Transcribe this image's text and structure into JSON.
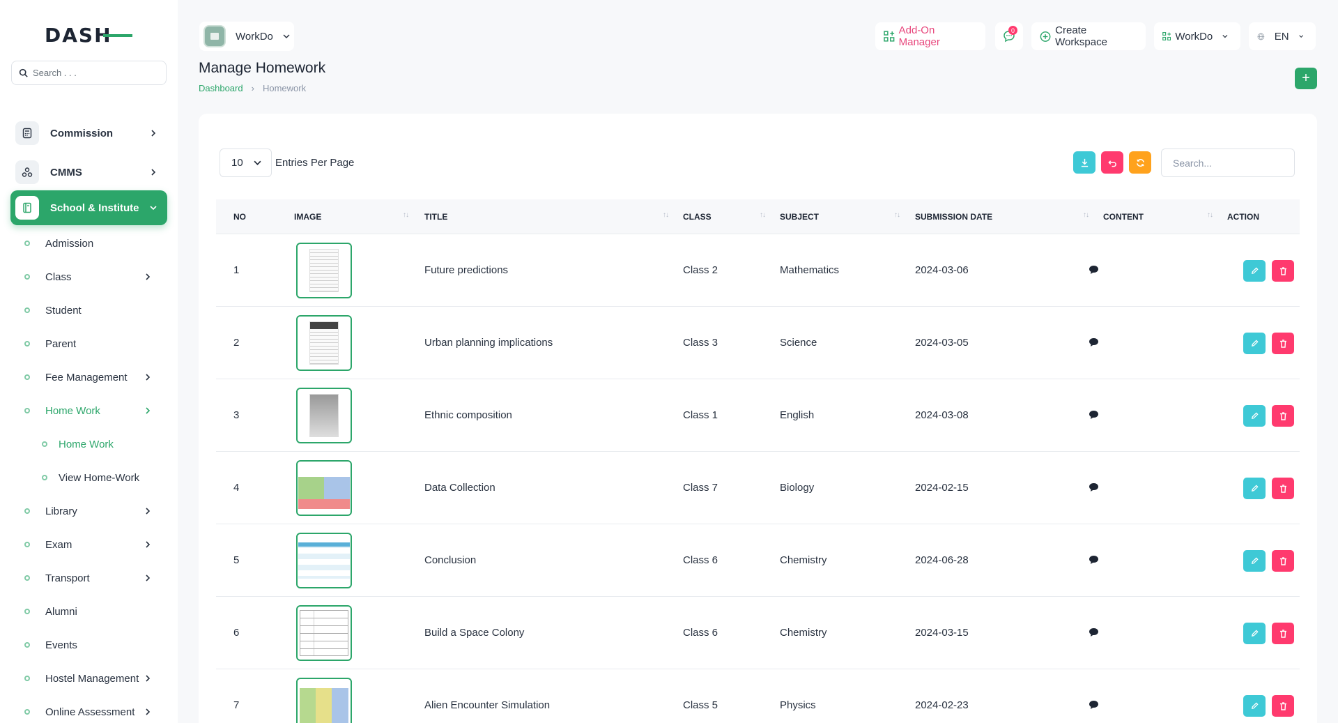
{
  "brand": {
    "logo_text": "DASH"
  },
  "sidebar": {
    "search_placeholder": "Search . . .",
    "items": [
      {
        "label": "Commission"
      },
      {
        "label": "CMMS"
      },
      {
        "label": "School & Institute"
      }
    ],
    "subitems": [
      {
        "label": "Admission"
      },
      {
        "label": "Class"
      },
      {
        "label": "Student"
      },
      {
        "label": "Parent"
      },
      {
        "label": "Fee Management"
      },
      {
        "label": "Home Work"
      },
      {
        "label": "Library"
      },
      {
        "label": "Exam"
      },
      {
        "label": "Transport"
      },
      {
        "label": "Alumni"
      },
      {
        "label": "Events"
      },
      {
        "label": "Hostel Management"
      },
      {
        "label": "Online Assessment"
      }
    ],
    "homework_children": [
      {
        "label": "Home Work"
      },
      {
        "label": "View Home-Work"
      }
    ]
  },
  "header": {
    "workspace": "WorkDo",
    "addon_manager": "Add-On Manager",
    "notification_count": "0",
    "create_workspace": "Create Workspace",
    "workspace_switch": "WorkDo",
    "language": "EN"
  },
  "page": {
    "title": "Manage Homework",
    "breadcrumb_home": "Dashboard",
    "breadcrumb_current": "Homework",
    "add_label": "+"
  },
  "table_controls": {
    "per_page": "10",
    "per_page_label": "Entries Per Page",
    "search_placeholder": "Search..."
  },
  "table": {
    "columns": [
      "NO",
      "IMAGE",
      "TITLE",
      "CLASS",
      "SUBJECT",
      "SUBMISSION DATE",
      "CONTENT",
      "ACTION"
    ],
    "rows": [
      {
        "no": "1",
        "title": "Future predictions",
        "class": "Class 2",
        "subject": "Mathematics",
        "date": "2024-03-06"
      },
      {
        "no": "2",
        "title": "Urban planning implications",
        "class": "Class 3",
        "subject": "Science",
        "date": "2024-03-05"
      },
      {
        "no": "3",
        "title": "Ethnic composition",
        "class": "Class 1",
        "subject": "English",
        "date": "2024-03-08"
      },
      {
        "no": "4",
        "title": "Data Collection",
        "class": "Class 7",
        "subject": "Biology",
        "date": "2024-02-15"
      },
      {
        "no": "5",
        "title": "Conclusion",
        "class": "Class 6",
        "subject": "Chemistry",
        "date": "2024-06-28"
      },
      {
        "no": "6",
        "title": "Build a Space Colony",
        "class": "Class 6",
        "subject": "Chemistry",
        "date": "2024-03-15"
      },
      {
        "no": "7",
        "title": "Alien Encounter Simulation",
        "class": "Class 5",
        "subject": "Physics",
        "date": "2024-02-23"
      }
    ]
  },
  "colors": {
    "accent": "#2ca66a",
    "info": "#3ec9d6",
    "danger": "#ff3a6e",
    "warning": "#ffa21d"
  }
}
